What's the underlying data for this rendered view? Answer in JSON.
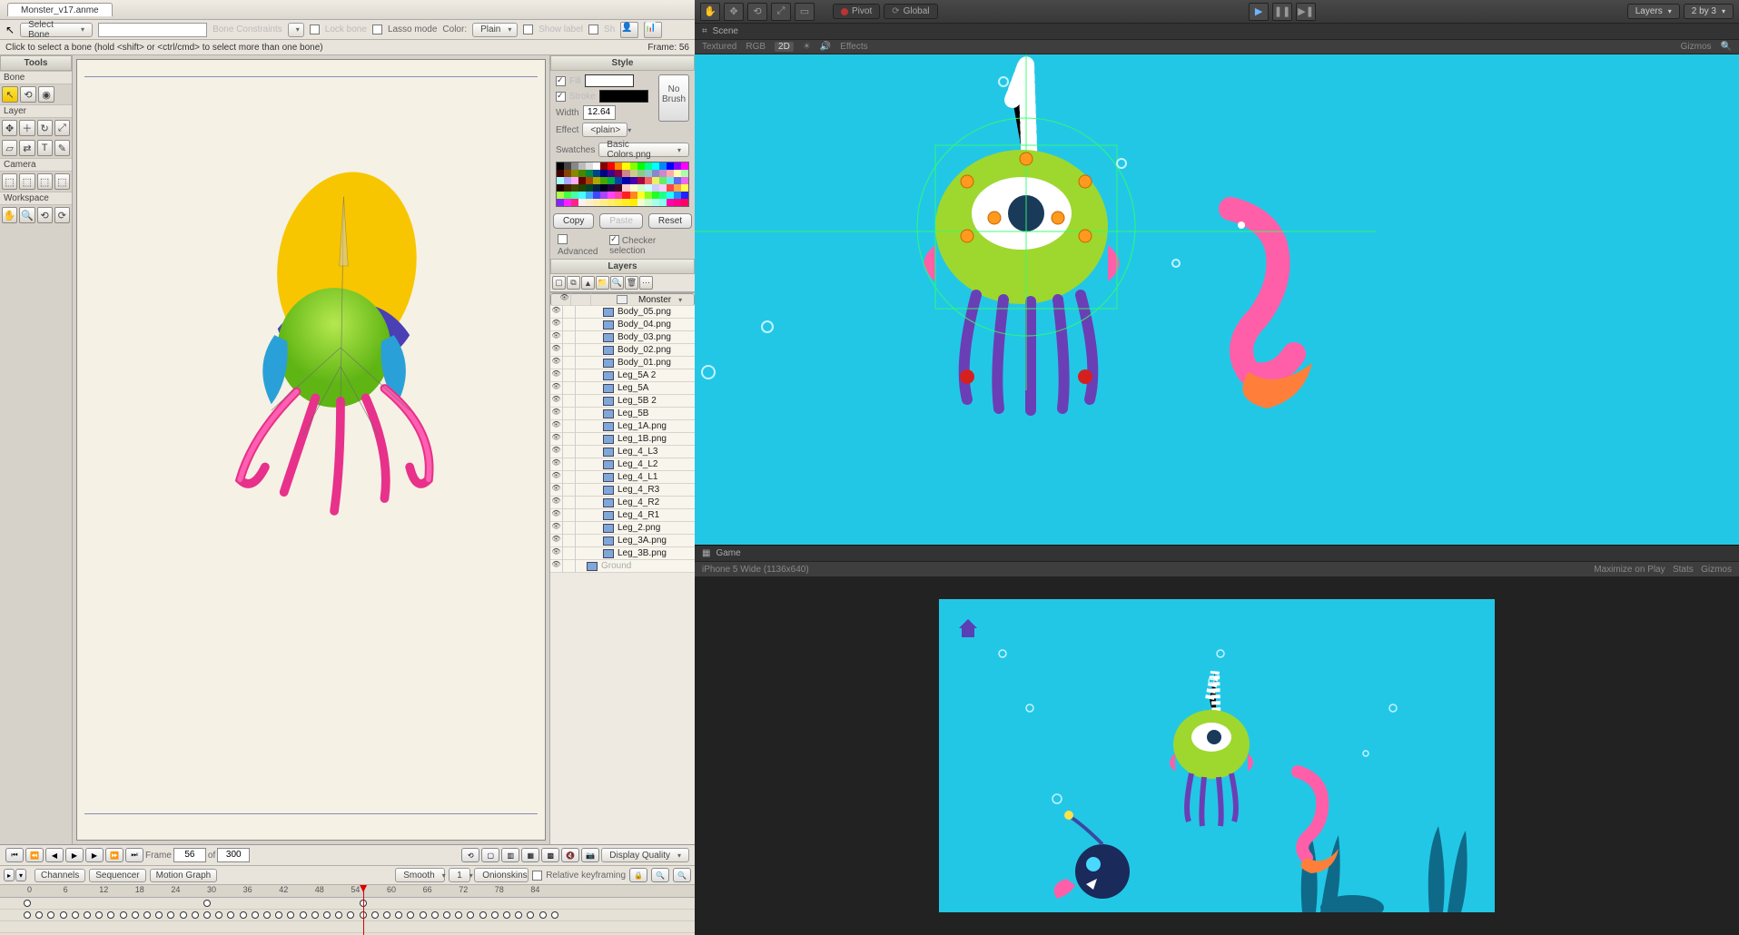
{
  "leftApp": {
    "filename": "Monster_v17.anme",
    "boneDropdown": "Select Bone",
    "boneConstraints": "Bone Constraints",
    "lockBone": "Lock bone",
    "lassoMode": "Lasso mode",
    "colorLabel": "Color:",
    "colorMode": "Plain",
    "showLabel": "Show label",
    "sh": "Sh",
    "statusHint": "Click to select a bone (hold <shift> or <ctrl/cmd> to select more than one bone)",
    "frameLabel": "Frame: 56",
    "tools": {
      "header": "Tools",
      "secBone": "Bone",
      "secLayer": "Layer",
      "secCamera": "Camera",
      "secWorkspace": "Workspace"
    },
    "style": {
      "header": "Style",
      "fill": "Fill",
      "stroke": "Stroke",
      "widthLabel": "Width",
      "widthValue": "12.64",
      "effectLabel": "Effect",
      "effectValue": "<plain>",
      "noBrush": "No Brush",
      "swatchesLabel": "Swatches",
      "swatchesValue": "Basic Colors.png",
      "copy": "Copy",
      "paste": "Paste",
      "reset": "Reset",
      "advanced": "Advanced",
      "checkerSel": "Checker selection"
    },
    "layers": {
      "header": "Layers",
      "items": [
        {
          "name": "Monster",
          "type": "bone",
          "selected": true,
          "indent": 0
        },
        {
          "name": "Body_05.png",
          "type": "img",
          "indent": 1
        },
        {
          "name": "Body_04.png",
          "type": "img",
          "indent": 1
        },
        {
          "name": "Body_03.png",
          "type": "img",
          "indent": 1
        },
        {
          "name": "Body_02.png",
          "type": "img",
          "indent": 1
        },
        {
          "name": "Body_01.png",
          "type": "img",
          "indent": 1
        },
        {
          "name": "Leg_5A 2",
          "type": "img",
          "indent": 1
        },
        {
          "name": "Leg_5A",
          "type": "img",
          "indent": 1
        },
        {
          "name": "Leg_5B 2",
          "type": "img",
          "indent": 1
        },
        {
          "name": "Leg_5B",
          "type": "img",
          "indent": 1
        },
        {
          "name": "Leg_1A.png",
          "type": "img",
          "indent": 1
        },
        {
          "name": "Leg_1B.png",
          "type": "img",
          "indent": 1
        },
        {
          "name": "Leg_4_L3",
          "type": "img",
          "indent": 1
        },
        {
          "name": "Leg_4_L2",
          "type": "img",
          "indent": 1
        },
        {
          "name": "Leg_4_L1",
          "type": "img",
          "indent": 1
        },
        {
          "name": "Leg_4_R3",
          "type": "img",
          "indent": 1
        },
        {
          "name": "Leg_4_R2",
          "type": "img",
          "indent": 1
        },
        {
          "name": "Leg_4_R1",
          "type": "img",
          "indent": 1
        },
        {
          "name": "Leg_2.png",
          "type": "img",
          "indent": 1
        },
        {
          "name": "Leg_3A.png",
          "type": "img",
          "indent": 1
        },
        {
          "name": "Leg_3B.png",
          "type": "img",
          "indent": 1
        },
        {
          "name": "Ground",
          "type": "vec",
          "indent": 0,
          "dim": true
        }
      ]
    },
    "timeline": {
      "frameLabel": "Frame",
      "frameValue": "56",
      "ofLabel": "of",
      "totalValue": "300",
      "displayQuality": "Display Quality",
      "tabs": [
        "Channels",
        "Sequencer",
        "Motion Graph"
      ],
      "smooth": "Smooth",
      "stepValue": "1",
      "onionskins": "Onionskins",
      "relKey": "Relative keyframing",
      "ticks": [
        0,
        6,
        12,
        18,
        24,
        30,
        36,
        42,
        48,
        54,
        60,
        66,
        72,
        78,
        84
      ],
      "playhead": 56
    }
  },
  "rightApp": {
    "pivot": "Pivot",
    "global": "Global",
    "layersDrop": "Layers",
    "layoutDrop": "2 by 3",
    "sceneTab": "Scene",
    "sceneSub": {
      "textured": "Textured",
      "rgb": "RGB",
      "twod": "2D",
      "effects": "Effects",
      "gizmos": "Gizmos"
    },
    "gameTab": "Game",
    "gameRes": "iPhone 5 Wide (1136x640)",
    "maximize": "Maximize on Play",
    "stats": "Stats",
    "gizmos2": "Gizmos"
  },
  "paletteColors": [
    "#000",
    "#444",
    "#888",
    "#bbb",
    "#ddd",
    "#fff",
    "#800",
    "#f00",
    "#f80",
    "#ff0",
    "#8f0",
    "#0f0",
    "#0f8",
    "#0ff",
    "#08f",
    "#00f",
    "#80f",
    "#f0f",
    "#400",
    "#840",
    "#880",
    "#480",
    "#084",
    "#048",
    "#008",
    "#408",
    "#804",
    "#c88",
    "#cc8",
    "#8c8",
    "#8cc",
    "#88c",
    "#c8c",
    "#faa",
    "#ffa",
    "#afa",
    "#aff",
    "#aaf",
    "#faf",
    "#600",
    "#a40",
    "#aa0",
    "#4a0",
    "#0a4",
    "#04a",
    "#00a",
    "#40a",
    "#a04",
    "#e66",
    "#ee6",
    "#6e6",
    "#6ee",
    "#66e",
    "#e6e",
    "#200",
    "#420",
    "#440",
    "#240",
    "#042",
    "#024",
    "#002",
    "#204",
    "#402",
    "#fcc",
    "#ffc",
    "#cfc",
    "#cff",
    "#ccf",
    "#fcf",
    "#f44",
    "#fa4",
    "#ff4",
    "#af4",
    "#4f4",
    "#4fa",
    "#4ff",
    "#4af",
    "#44f",
    "#a4f",
    "#f4f",
    "#f4a",
    "#f22",
    "#f82",
    "#ff2",
    "#8f2",
    "#2f2",
    "#2f8",
    "#2ff",
    "#28f",
    "#22f",
    "#82f",
    "#f2f",
    "#f28",
    "#fee",
    "#fec",
    "#fea",
    "#fe8",
    "#fe6",
    "#fe4",
    "#fe2",
    "#fe0",
    "#efc",
    "#cfc",
    "#afe",
    "#8fe",
    "#f0a",
    "#f08",
    "#f06"
  ]
}
